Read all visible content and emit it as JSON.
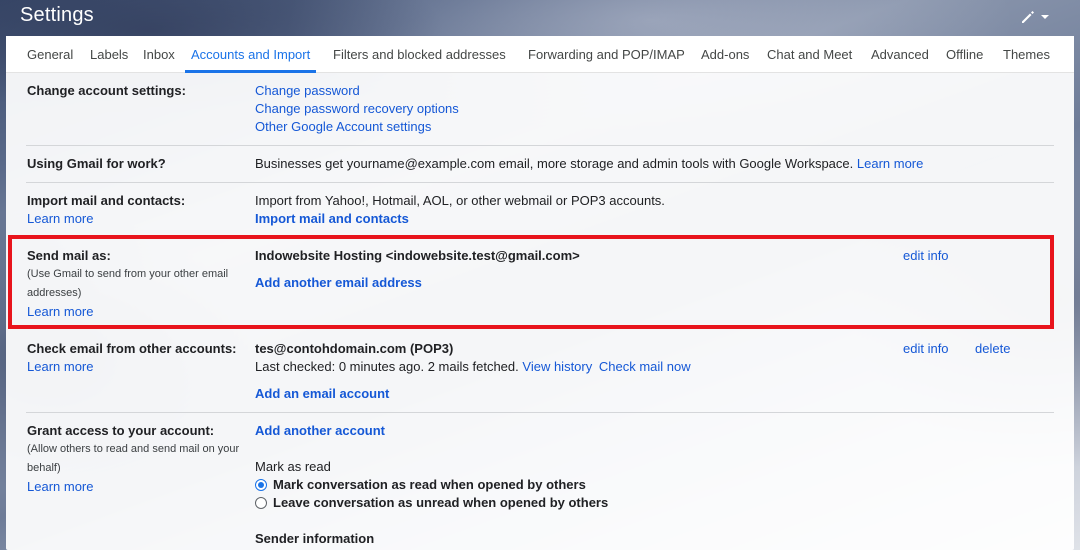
{
  "header": {
    "title": "Settings"
  },
  "tabs": [
    {
      "label": "General"
    },
    {
      "label": "Labels"
    },
    {
      "label": "Inbox"
    },
    {
      "label": "Accounts and Import"
    },
    {
      "label": "Filters and blocked addresses"
    },
    {
      "label": "Forwarding and POP/IMAP"
    },
    {
      "label": "Add-ons"
    },
    {
      "label": "Chat and Meet"
    },
    {
      "label": "Advanced"
    },
    {
      "label": "Offline"
    },
    {
      "label": "Themes"
    }
  ],
  "active_tab": "Accounts and Import",
  "change_account": {
    "label": "Change account settings:",
    "links": [
      "Change password",
      "Change password recovery options",
      "Other Google Account settings"
    ]
  },
  "gmail_work": {
    "label": "Using Gmail for work?",
    "text": "Businesses get yourname@example.com email, more storage and admin tools with Google Workspace.",
    "learn_more": "Learn more"
  },
  "import_mail": {
    "label": "Import mail and contacts:",
    "learn_more": "Learn more",
    "text": "Import from Yahoo!, Hotmail, AOL, or other webmail or POP3 accounts.",
    "action": "Import mail and contacts"
  },
  "send_mail_as": {
    "label": "Send mail as:",
    "sub": "(Use Gmail to send from your other email addresses)",
    "learn_more": "Learn more",
    "address": "Indowebsite Hosting <indowebsite.test@gmail.com>",
    "edit": "edit info",
    "add": "Add another email address"
  },
  "check_email": {
    "label": "Check email from other accounts:",
    "learn_more": "Learn more",
    "account": "tes@contohdomain.com (POP3)",
    "status": "Last checked: 0 minutes ago. 2 mails fetched.",
    "view_history": "View history",
    "check_now": "Check mail now",
    "edit": "edit info",
    "delete": "delete",
    "add": "Add an email account"
  },
  "grant_access": {
    "label": "Grant access to your account:",
    "sub": "(Allow others to read and send mail on your behalf)",
    "learn_more": "Learn more",
    "add": "Add another account",
    "mark_as_read_title": "Mark as read",
    "option_1": "Mark conversation as read when opened by others",
    "option_2": "Leave conversation as unread when opened by others",
    "selected_option": 1,
    "sender_info_title": "Sender information"
  },
  "colors": {
    "accent": "#1a73e8",
    "link": "#1558d6",
    "highlight": "#e8141c"
  }
}
